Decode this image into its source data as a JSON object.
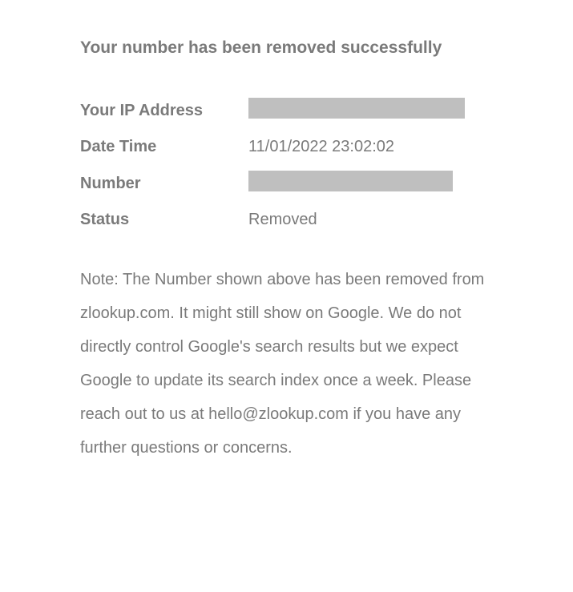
{
  "heading": "Your number has been removed successfully",
  "info": {
    "ip_label": "Your IP Address",
    "ip_value": "",
    "datetime_label": "Date Time",
    "datetime_value": "11/01/2022 23:02:02",
    "number_label": "Number",
    "number_value": "",
    "status_label": "Status",
    "status_value": "Removed"
  },
  "note_text": "Note: The Number shown above has been removed from zlookup.com. It might still show on Google. We do not directly control Google's search results but we expect Google to update its search index once a week. Please reach out to us at hello@zlookup.com if you have any further questions or concerns."
}
